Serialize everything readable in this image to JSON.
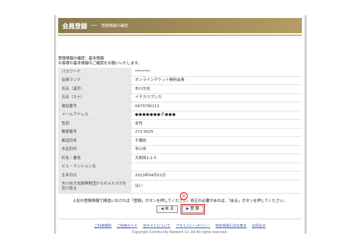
{
  "banner": {
    "title": "会員登録",
    "separator": "──",
    "subtitle": "登録情報の確認"
  },
  "intro": {
    "line1": "登録情報の確認：基本情報",
    "line2": "お客様の基本情報のご確認をお願いいたします。"
  },
  "rows": [
    {
      "label": "パスワード",
      "value": "********"
    },
    {
      "label": "会員ランク",
      "value": "オンラインチケット無料会員"
    },
    {
      "label": "氏名（漢字）",
      "value": "市川文化"
    },
    {
      "label": "氏名（カナ）",
      "value": "イチカワブンカ"
    },
    {
      "label": "電話番号",
      "value": "0473795111"
    },
    {
      "label": "メールアドレス",
      "value": "●●●●●●●＠●●●"
    },
    {
      "label": "性別",
      "value": "女性"
    },
    {
      "label": "郵便番号",
      "value": "272-0025"
    },
    {
      "label": "都道府県",
      "value": "千葉県"
    },
    {
      "label": "市区町村",
      "value": "市川市"
    },
    {
      "label": "町名・番地",
      "value": "大和田1-1-5"
    },
    {
      "label": "ビル・マンション名",
      "value": ""
    },
    {
      "label": "生年月日",
      "value": "2023年04月01日"
    },
    {
      "label": "市川市文化振興財団からのメルマガを受け取る",
      "value": "はい"
    }
  ],
  "notice": "上記の登録情報で間違いなければ「登録」ボタンを押してください。修正の必要があれば、「戻る」ボタンを押してください。",
  "step_marker": "⑤",
  "buttons": {
    "back": "戻 る",
    "register": "登 録",
    "arrow": "▶"
  },
  "footer": {
    "links": [
      "ご利用規約",
      "ご利用ガイド",
      "当サイトについて",
      "プライバシーポリシー",
      "特定商取引法の表示",
      "お問合せ"
    ],
    "copyright": "Copyright Community Network Co.,ltd All rights reserved."
  }
}
